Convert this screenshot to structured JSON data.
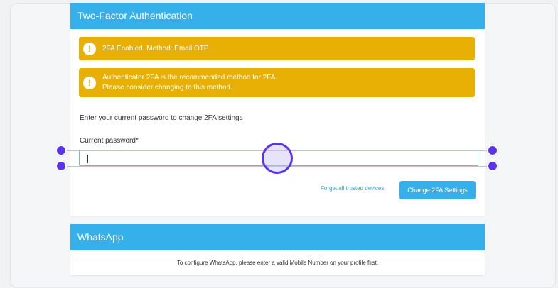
{
  "two_factor": {
    "title": "Two-Factor Authentication",
    "alerts": [
      {
        "icon": "exclamation-icon",
        "glyph": "!",
        "lines": [
          "2FA Enabled. Method: Email OTP"
        ]
      },
      {
        "icon": "exclamation-icon",
        "glyph": "!",
        "lines": [
          "Authenticator 2FA is the recommended method for 2FA.",
          "Please consider changing to this method."
        ]
      }
    ],
    "instructions": "Enter your current password to change 2FA settings",
    "password_label": "Current password*",
    "password_value": "",
    "forget_devices_link": "Forget all trusted devices",
    "change_button": "Change 2FA Settings"
  },
  "whatsapp": {
    "title": "WhatsApp",
    "message": "To configure WhatsApp, please enter a valid Mobile Number on your profile first."
  },
  "colors": {
    "header_blue": "#35b0eb",
    "alert_yellow": "#e8b004",
    "handle_purple": "#5b34e8"
  }
}
